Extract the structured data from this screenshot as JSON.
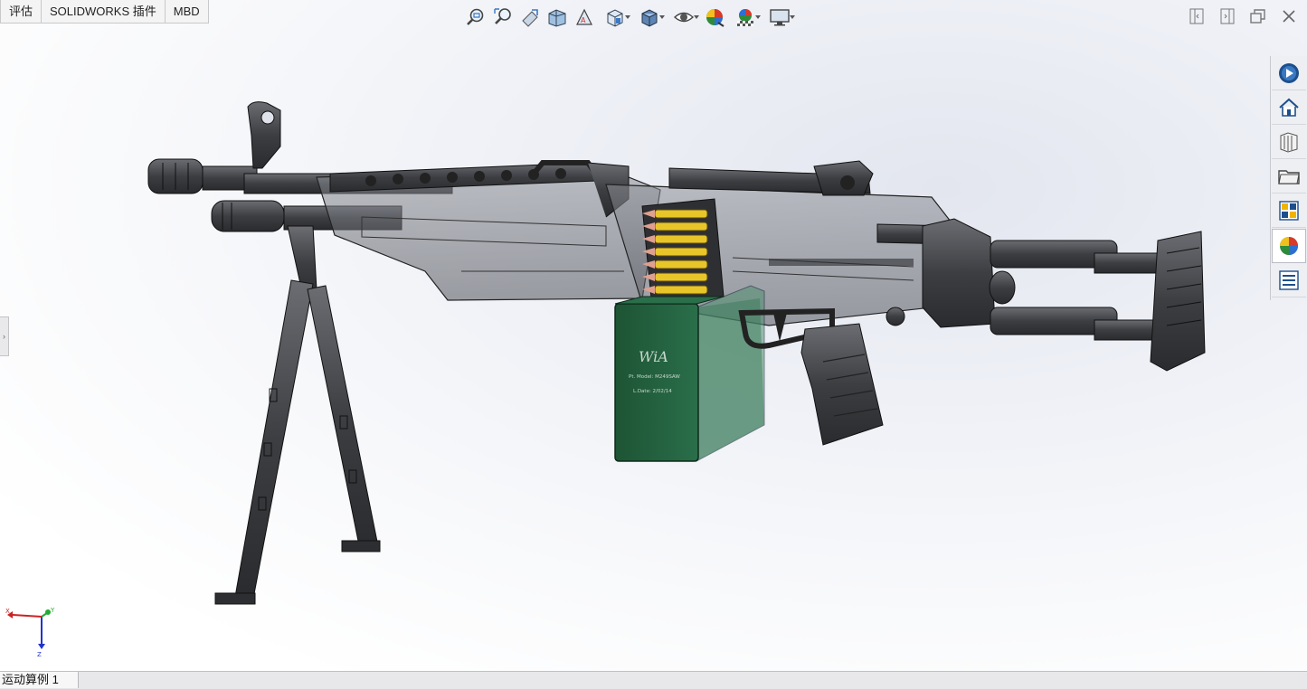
{
  "command_tabs": [
    "评估",
    "SOLIDWORKS 插件",
    "MBD"
  ],
  "hud_toolbar": {
    "icons": [
      "zoom-to-fit-icon",
      "zoom-to-area-icon",
      "previous-view-icon",
      "section-view-icon",
      "dynamic-annotation-icon",
      "view-orientation-icon",
      "display-style-icon",
      "hide-show-items-icon",
      "edit-appearance-icon",
      "apply-scene-icon",
      "view-settings-icon"
    ]
  },
  "window_controls": [
    "tile-left-icon",
    "tile-right-icon",
    "restore-icon",
    "close-icon"
  ],
  "task_pane": [
    "solidworks-resources-icon",
    "home-icon",
    "design-library-icon",
    "file-explorer-icon",
    "view-palette-icon",
    "appearances-icon",
    "custom-properties-icon"
  ],
  "model": {
    "magazine_logo": "WiA",
    "magazine_line1": "Pt. Model: M249SAW",
    "magazine_line2": "L.Date: 2/02/14"
  },
  "triad": {
    "x": "X",
    "y": "Y",
    "z": "Z"
  },
  "bottom_tabs": [
    "运动算例 1"
  ],
  "colors": {
    "magazine_green": "#1f5a3a",
    "ammo_brass": "#e8c62a",
    "gun_dark": "#3a3b3e"
  }
}
